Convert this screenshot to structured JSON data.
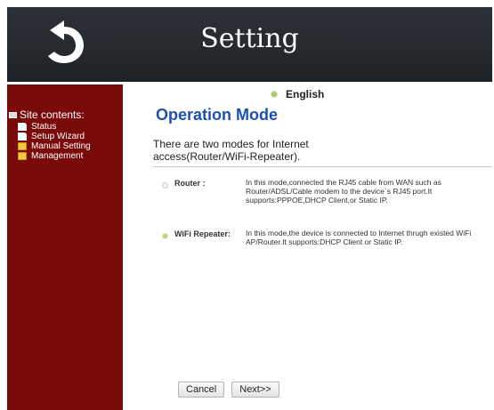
{
  "header": {
    "title": "Setting",
    "back_icon": "back-arrow-icon"
  },
  "sidebar": {
    "title": "Site contents:",
    "items": [
      {
        "label": "Status",
        "icon": "document-icon"
      },
      {
        "label": "Setup Wizard",
        "icon": "document-icon"
      },
      {
        "label": "Manual Setting",
        "icon": "folder-icon"
      },
      {
        "label": "Management",
        "icon": "folder-icon"
      }
    ]
  },
  "main": {
    "language": "English",
    "title": "Operation Mode",
    "intro": "There are two modes for Internet access(Router/WiFi-Repeater).",
    "modes": [
      {
        "label": "Router :",
        "description": "In this mode,connected the RJ45 cable from WAN such as Router/ADSL/Cable modem to the device`s RJ45 port.It supports:PPPOE,DHCP Client,or Static IP.",
        "selected": false
      },
      {
        "label": "WiFi Repeater:",
        "description": "In this mode,the device is connected to Internet thrugh existed WiFi AP/Router.It supports:DHCP Client or Static IP.",
        "selected": true
      }
    ],
    "buttons": {
      "cancel": "Cancel",
      "next": "Next>>"
    }
  },
  "colors": {
    "header_bg": "#262b30",
    "sidebar_bg": "#7a0a09",
    "title_blue": "#1d4fb4",
    "radio_selected": "#b8d57c"
  }
}
